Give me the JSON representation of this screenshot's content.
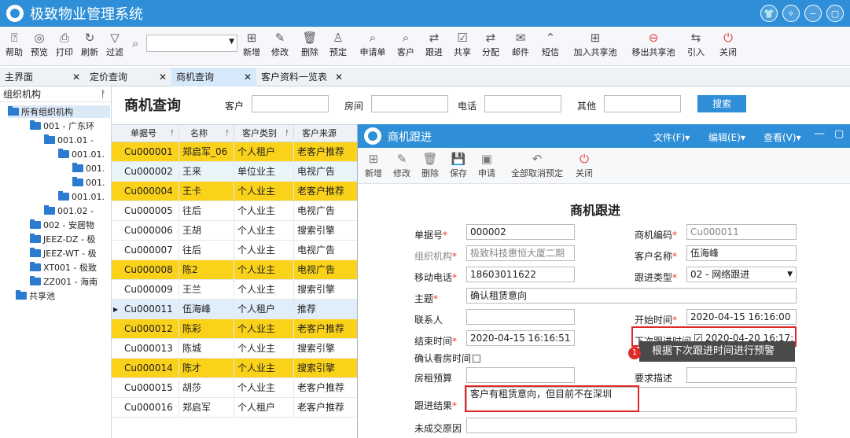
{
  "app": {
    "title": "极致物业管理系统"
  },
  "toolbar": {
    "items": [
      {
        "label": "帮助",
        "icon": "help-icon",
        "glyph": "⍰"
      },
      {
        "label": "预览",
        "icon": "eye-icon",
        "glyph": "◎"
      },
      {
        "label": "打印",
        "icon": "printer-icon",
        "glyph": "⎙"
      },
      {
        "label": "刷新",
        "icon": "refresh-icon",
        "glyph": "↻"
      },
      {
        "label": "过滤",
        "icon": "filter-icon",
        "glyph": "▽"
      },
      {
        "label": "新增",
        "icon": "add-icon",
        "glyph": "⊞"
      },
      {
        "label": "修改",
        "icon": "edit-icon",
        "glyph": "✎"
      },
      {
        "label": "删除",
        "icon": "trash-icon",
        "glyph": "🗑"
      },
      {
        "label": "预定",
        "icon": "user-icon",
        "glyph": "♙"
      },
      {
        "label": "申请单",
        "icon": "search-icon",
        "glyph": "⌕"
      },
      {
        "label": "客户",
        "icon": "search-icon",
        "glyph": "⌕"
      },
      {
        "label": "跟进",
        "icon": "arrows-icon",
        "glyph": "⇄"
      },
      {
        "label": "共享",
        "icon": "share-icon",
        "glyph": "☑"
      },
      {
        "label": "分配",
        "icon": "arrows-icon",
        "glyph": "⇄"
      },
      {
        "label": "邮件",
        "icon": "mail-icon",
        "glyph": "✉"
      },
      {
        "label": "短信",
        "icon": "chevron-up-icon",
        "glyph": "⌃"
      },
      {
        "label": "加入共享池",
        "icon": "add-icon",
        "glyph": "⊞"
      },
      {
        "label": "移出共享池",
        "icon": "minus-circle-icon",
        "glyph": "⊖"
      },
      {
        "label": "引入",
        "icon": "import-icon",
        "glyph": "⇆"
      },
      {
        "label": "关闭",
        "icon": "power-icon",
        "glyph": "⏻"
      }
    ]
  },
  "tabs": [
    {
      "label": "主界面"
    },
    {
      "label": "定价查询"
    },
    {
      "label": "商机查询"
    },
    {
      "label": "客户资料一览表"
    }
  ],
  "sidebar": {
    "title": "组织机构",
    "items": [
      {
        "label": "所有组织机构"
      },
      {
        "label": "001 - 广东环"
      },
      {
        "label": "001.01 -"
      },
      {
        "label": "001.01."
      },
      {
        "label": "001."
      },
      {
        "label": "001."
      },
      {
        "label": "001.01."
      },
      {
        "label": "001.02 -"
      },
      {
        "label": "002 - 安居物"
      },
      {
        "label": "JEEZ-DZ - 极"
      },
      {
        "label": "JEEZ-WT - 极"
      },
      {
        "label": "XT001 - 极致"
      },
      {
        "label": "ZZ001 - 海南"
      },
      {
        "label": "共享池"
      }
    ]
  },
  "query": {
    "title": "商机查询",
    "fields": [
      {
        "label": "客户"
      },
      {
        "label": "房间"
      },
      {
        "label": "电话"
      },
      {
        "label": "其他"
      }
    ],
    "search_label": "搜索"
  },
  "grid": {
    "headers": [
      "单据号",
      "名称",
      "客户类别",
      "客户来源"
    ],
    "rows": [
      {
        "no": "Cu000001",
        "name": "郑启军_06",
        "type": "个人租户",
        "source": "老客户推荐"
      },
      {
        "no": "Cu000002",
        "name": "王来",
        "type": "单位业主",
        "source": "电视广告"
      },
      {
        "no": "Cu000004",
        "name": "王卡",
        "type": "个人业主",
        "source": "老客户推荐"
      },
      {
        "no": "Cu000005",
        "name": "往后",
        "type": "个人业主",
        "source": "电视广告"
      },
      {
        "no": "Cu000006",
        "name": "王胡",
        "type": "个人业主",
        "source": "搜索引擎"
      },
      {
        "no": "Cu000007",
        "name": "往后",
        "type": "个人业主",
        "source": "电视广告"
      },
      {
        "no": "Cu000008",
        "name": "陈2",
        "type": "个人业主",
        "source": "电视广告"
      },
      {
        "no": "Cu000009",
        "name": "王兰",
        "type": "个人业主",
        "source": "搜索引擎"
      },
      {
        "no": "Cu000011",
        "name": "伍海峰",
        "type": "个人租户",
        "source": "推荐"
      },
      {
        "no": "Cu000012",
        "name": "陈彩",
        "type": "个人业主",
        "source": "老客户推荐"
      },
      {
        "no": "Cu000013",
        "name": "陈城",
        "type": "个人业主",
        "source": "搜索引擎"
      },
      {
        "no": "Cu000014",
        "name": "陈才",
        "type": "个人业主",
        "source": "搜索引擎"
      },
      {
        "no": "Cu000015",
        "name": "胡莎",
        "type": "个人业主",
        "source": "老客户推荐"
      },
      {
        "no": "Cu000016",
        "name": "郑启军",
        "type": "个人租户",
        "source": "老客户推荐"
      }
    ]
  },
  "dialog": {
    "title": "商机跟进",
    "menus": [
      "文件(F)▾",
      "编辑(E)▾",
      "查看(V)▾"
    ],
    "tools": [
      {
        "label": "新增",
        "glyph": "⊞"
      },
      {
        "label": "修改",
        "glyph": "✎"
      },
      {
        "label": "删除",
        "glyph": "🗑"
      },
      {
        "label": "保存",
        "glyph": "💾"
      },
      {
        "label": "申请",
        "glyph": "▣"
      },
      {
        "label": "全部取消预定",
        "glyph": "↶"
      },
      {
        "label": "关闭",
        "glyph": "⏻"
      }
    ],
    "form_title": "商机跟进",
    "fields": {
      "doc_no": {
        "label": "单据号",
        "value": "000002"
      },
      "biz_code": {
        "label": "商机编码",
        "value": "Cu000011"
      },
      "org": {
        "label": "组织机构",
        "value": "极致科技惠恒大厦二期"
      },
      "customer": {
        "label": "客户名称",
        "value": "伍海峰"
      },
      "mobile": {
        "label": "移动电话",
        "value": "18603011622"
      },
      "follow_type": {
        "label": "跟进类型",
        "value": "02 - 网络跟进"
      },
      "subject": {
        "label": "主题",
        "value": "确认租赁意向"
      },
      "contact": {
        "label": "联系人",
        "value": ""
      },
      "start_time": {
        "label": "开始时间",
        "value": "2020-04-15 16:16:00"
      },
      "end_time": {
        "label": "结束时间",
        "value": "2020-04-15 16:16:51"
      },
      "next_time": {
        "label": "下次跟进时间",
        "value": "2020-04-20 16:17:"
      },
      "confirm_view": {
        "label": "确认看房时间",
        "value": ""
      },
      "budget": {
        "label": "房租预算",
        "value": ""
      },
      "requirement": {
        "label": "要求描述",
        "value": ""
      },
      "result": {
        "label": "跟进结果",
        "value": "客户有租赁意向，但目前不在深圳"
      },
      "reason": {
        "label": "未成交原因",
        "value": ""
      }
    },
    "tooltip": {
      "number": "1",
      "text": "根据下次跟进时间进行预警"
    }
  }
}
